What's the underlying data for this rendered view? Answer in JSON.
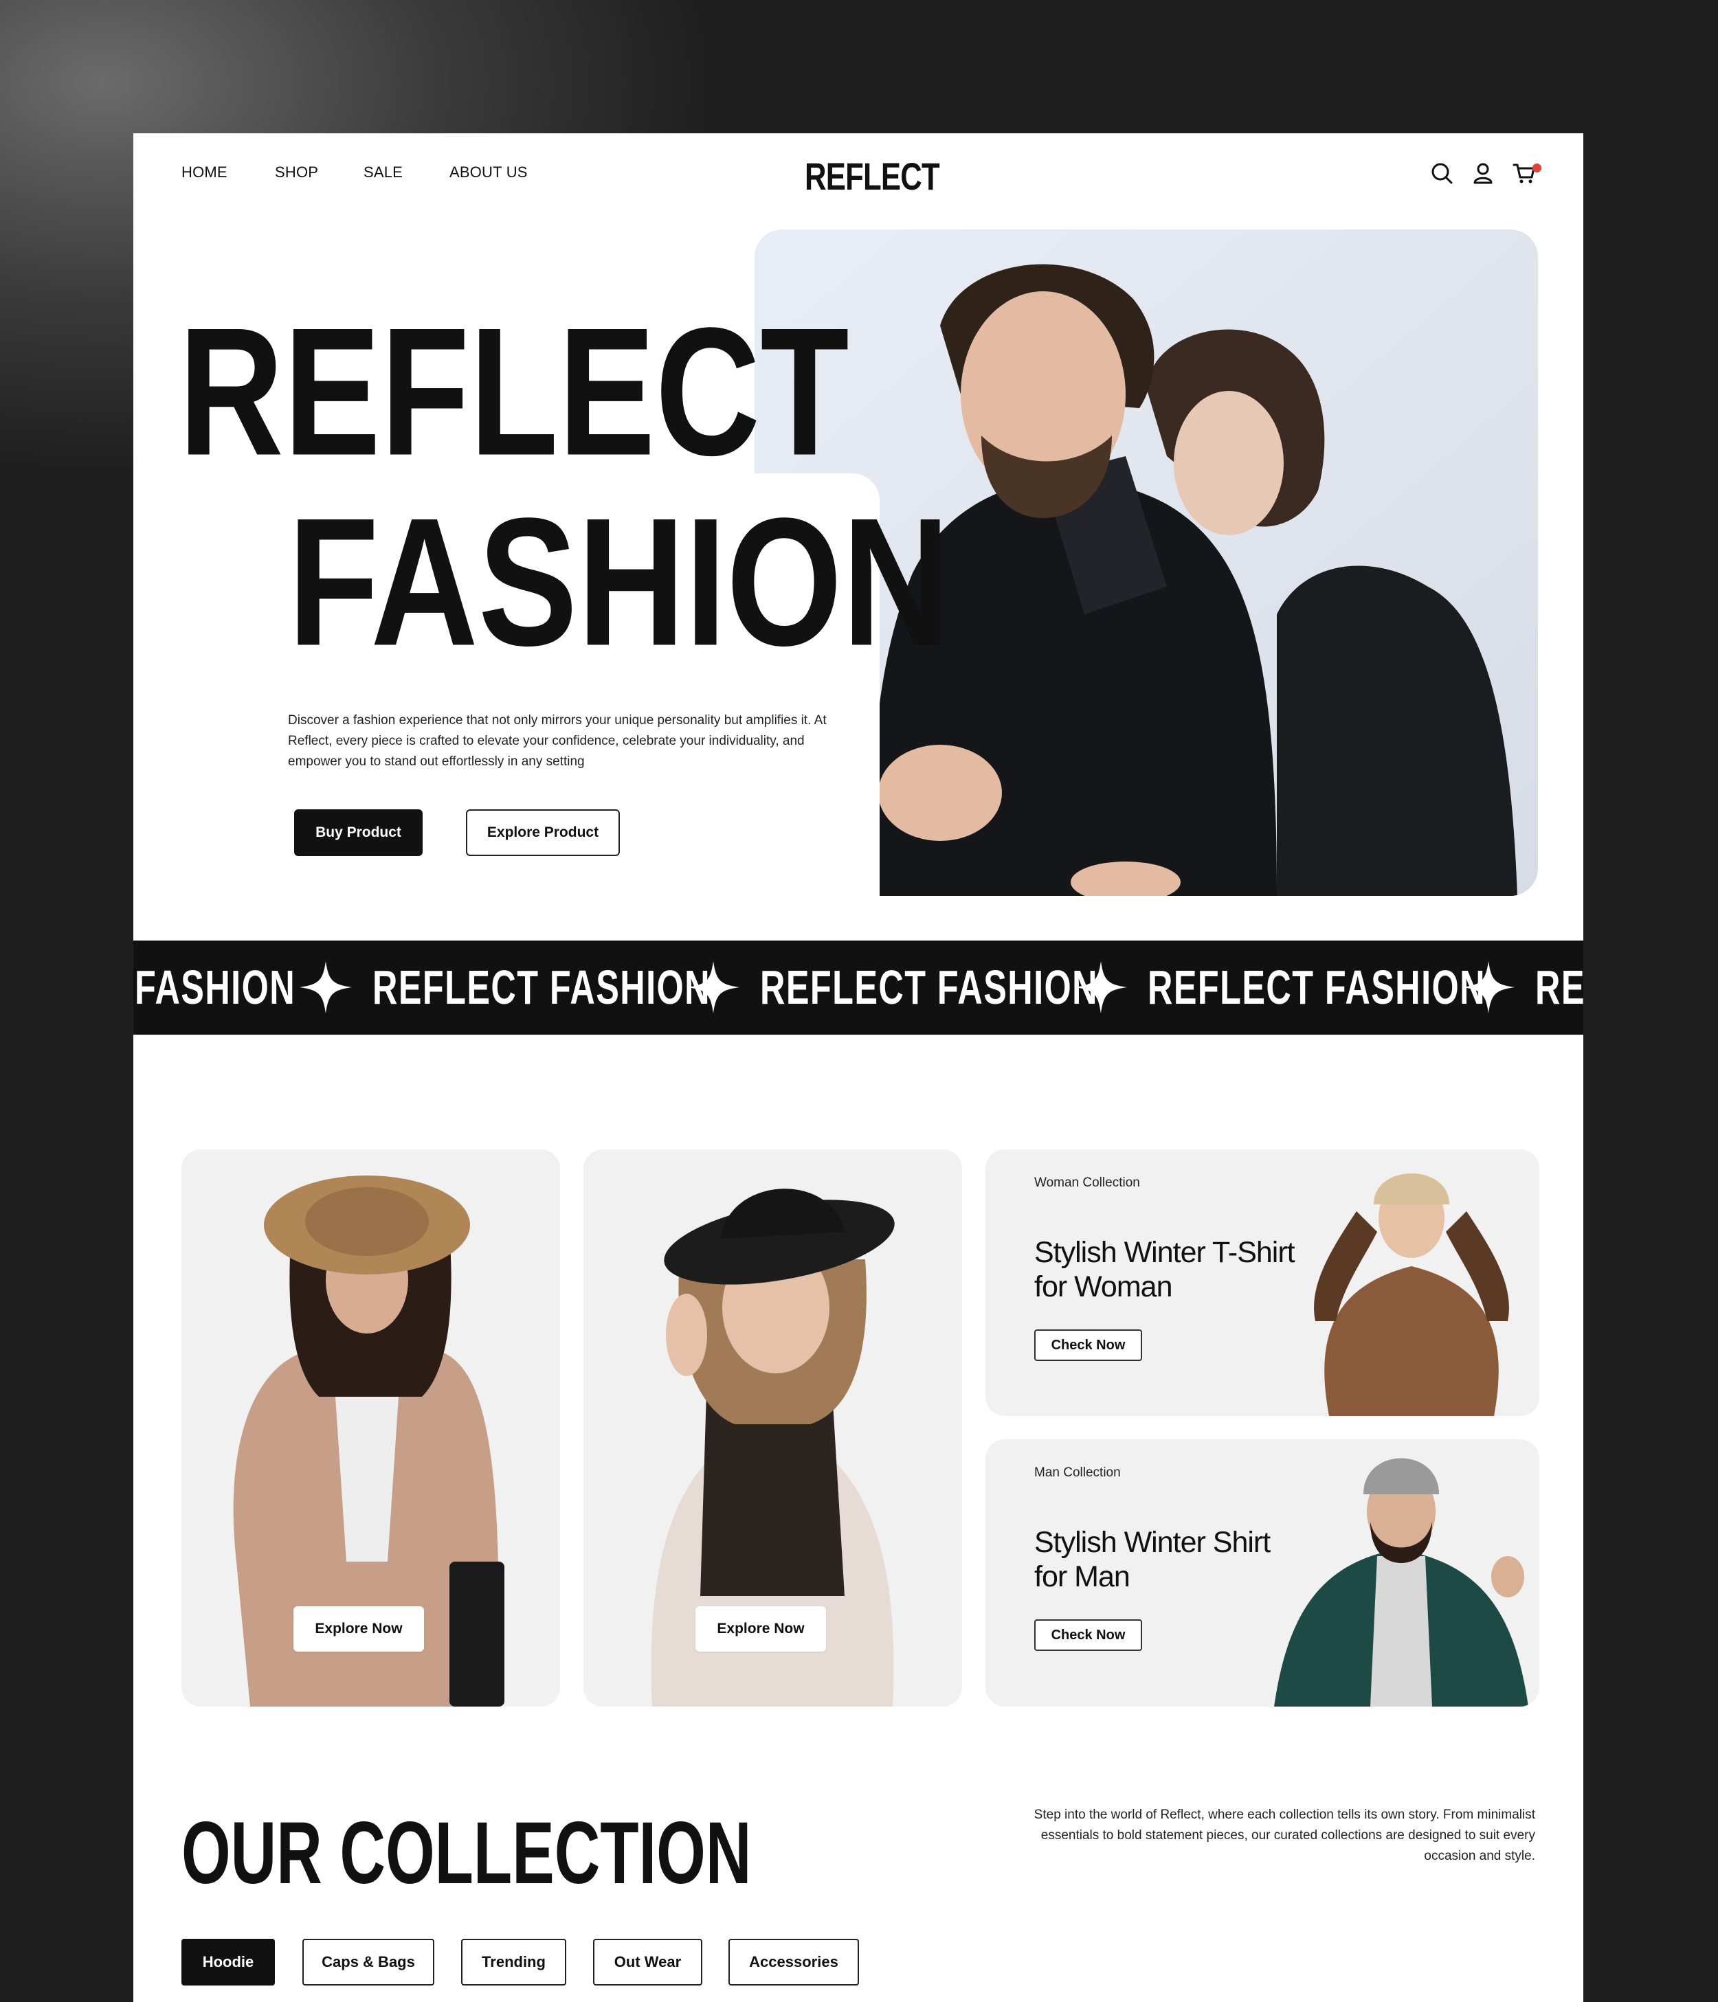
{
  "nav": {
    "links": [
      "HOME",
      "SHOP",
      "SALE",
      "ABOUT US"
    ],
    "logo": "REFLECT",
    "icons": [
      "search-icon",
      "user-icon",
      "cart-icon"
    ],
    "cart_badge_color": "#e0433b"
  },
  "hero": {
    "headline_line1": "REFLECT",
    "headline_line2": "FASHION",
    "description": "Discover a fashion experience that not only mirrors your unique personality but amplifies it. At Reflect, every piece is crafted to elevate your confidence, celebrate your individuality, and empower you to stand out effortlessly in any setting",
    "buy_label": "Buy Product",
    "explore_label": "Explore Product"
  },
  "marquee": {
    "items": [
      "FASHION",
      "REFLECT FASHION",
      "REFLECT FASHION",
      "REFLECT FASHION",
      "REFLECT FASHION"
    ]
  },
  "cards": {
    "explore_label": "Explore Now",
    "woman": {
      "label": "Woman Collection",
      "title_line1": "Stylish Winter T-Shirt",
      "title_line2": "for Woman",
      "button": "Check Now"
    },
    "man": {
      "label": "Man Collection",
      "title_line1": "Stylish Winter Shirt",
      "title_line2": "for Man",
      "button": "Check Now"
    }
  },
  "collection": {
    "title": "OUR COLLECTION",
    "description": "Step into the world of Reflect, where each collection tells its own story. From minimalist essentials to bold statement pieces, our curated collections are designed to suit every occasion and style.",
    "tabs": [
      "Hoodie",
      "Caps & Bags",
      "Trending",
      "Out Wear",
      "Accessories"
    ],
    "active_tab": "Hoodie"
  },
  "colors": {
    "primary": "#111111",
    "accent_badge": "#e0433b",
    "card_bg": "#f1f1f1"
  }
}
